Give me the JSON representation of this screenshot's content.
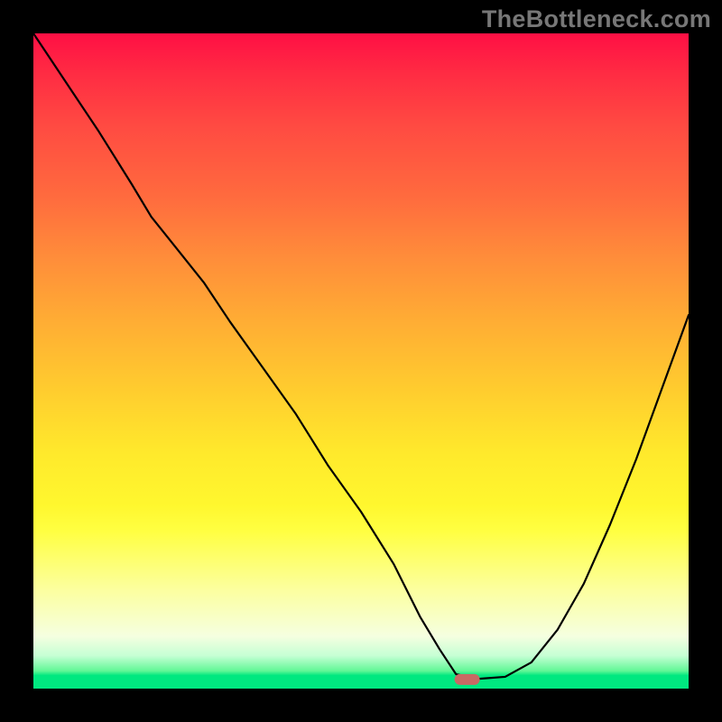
{
  "watermark": "TheBottleneck.com",
  "chart_data": {
    "type": "line",
    "title": "",
    "xlabel": "",
    "ylabel": "",
    "xlim": [
      0,
      100
    ],
    "ylim": [
      0,
      100
    ],
    "grid": false,
    "legend": false,
    "background_gradient": {
      "direction": "vertical",
      "stops": [
        {
          "pos": 0,
          "color": "#ff0f44"
        },
        {
          "pos": 25,
          "color": "#ff6b3e"
        },
        {
          "pos": 55,
          "color": "#ffce2e"
        },
        {
          "pos": 76,
          "color": "#ffff42"
        },
        {
          "pos": 92,
          "color": "#f5ffe0"
        },
        {
          "pos": 98,
          "color": "#00e880"
        }
      ]
    },
    "series": [
      {
        "name": "bottleneck-curve",
        "x": [
          0,
          2,
          6,
          10,
          15,
          18,
          22,
          26,
          30,
          35,
          40,
          45,
          50,
          55,
          59,
          62,
          64.5,
          68,
          72,
          76,
          80,
          84,
          88,
          92,
          96,
          100
        ],
        "y": [
          100,
          97,
          91,
          85,
          77,
          72,
          67,
          62,
          56,
          49,
          42,
          34,
          27,
          19,
          11,
          6,
          2.2,
          1.5,
          1.8,
          4,
          9,
          16,
          25,
          35,
          46,
          57
        ]
      }
    ],
    "marker": {
      "name": "optimal-point",
      "x": 66.2,
      "y": 1.4,
      "shape": "pill",
      "color": "#c86964"
    }
  }
}
